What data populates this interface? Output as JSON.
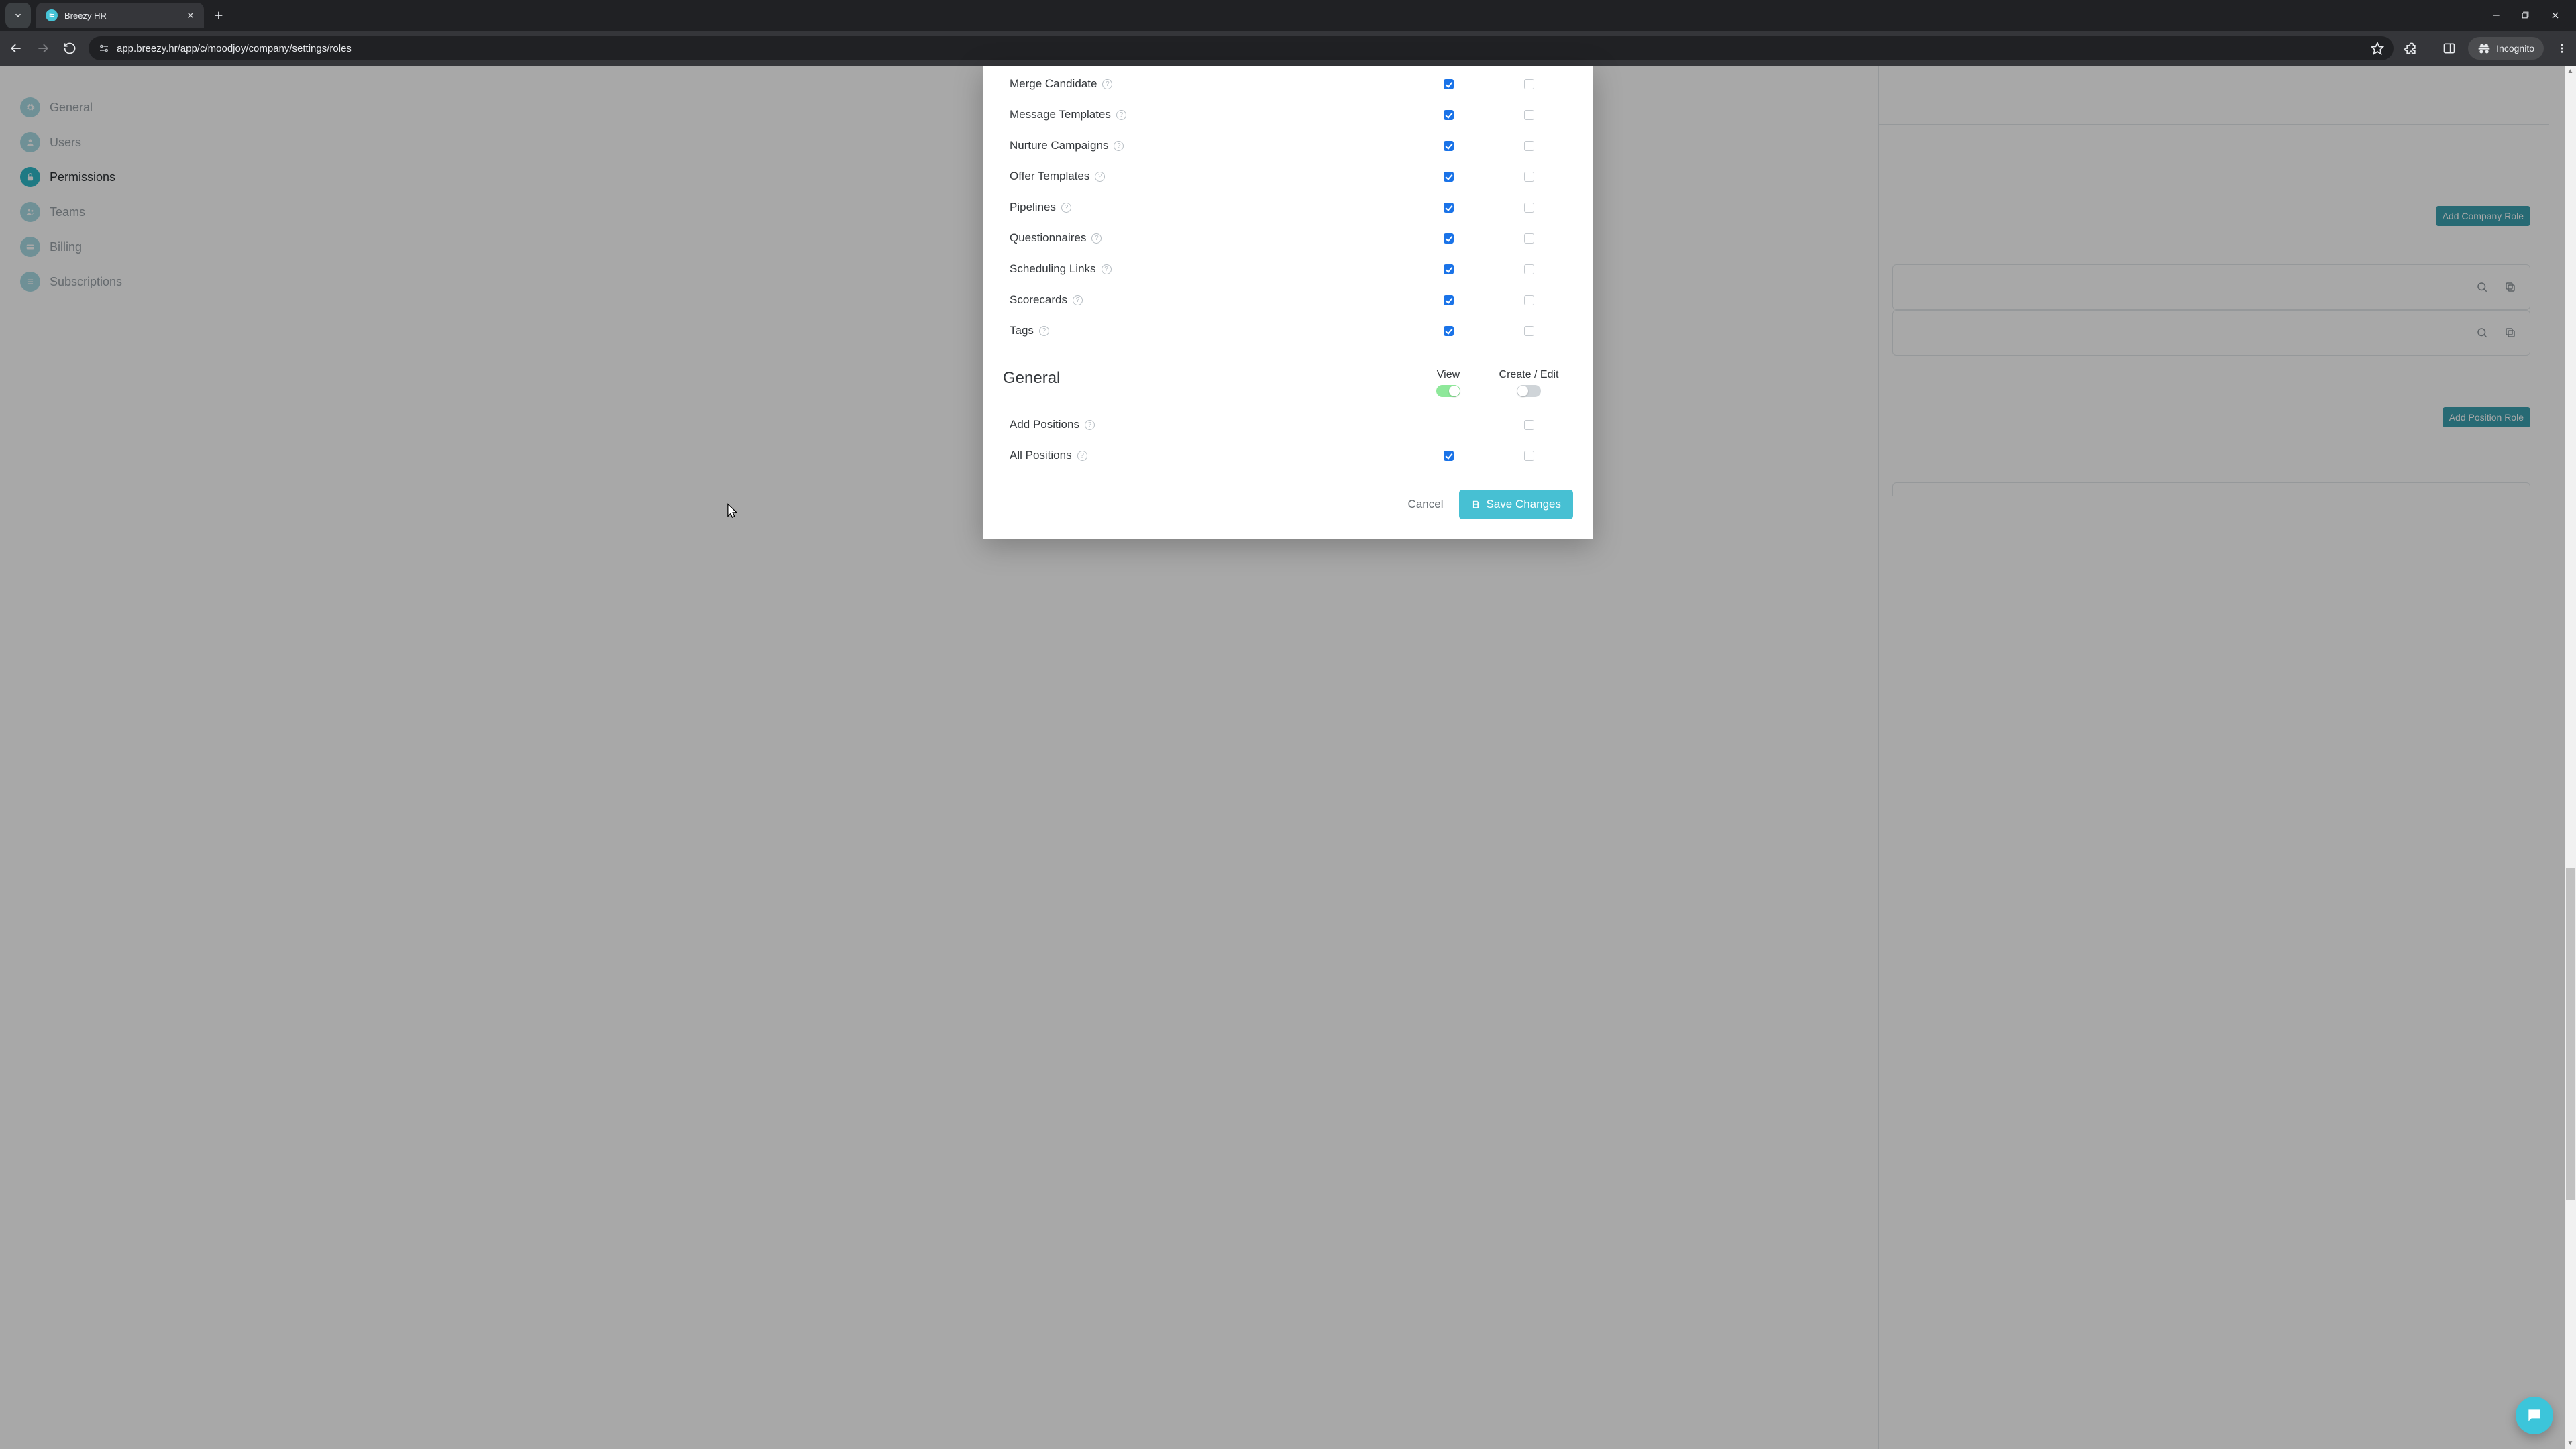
{
  "browser": {
    "tab_title": "Breezy HR",
    "url": "app.breezy.hr/app/c/moodjoy/company/settings/roles",
    "incognito_label": "Incognito"
  },
  "sidebar": {
    "items": [
      {
        "label": "General"
      },
      {
        "label": "Users"
      },
      {
        "label": "Permissions"
      },
      {
        "label": "Teams"
      },
      {
        "label": "Billing"
      },
      {
        "label": "Subscriptions"
      }
    ]
  },
  "background": {
    "add_company_role": "Add Company Role",
    "add_position_role": "Add Position Role"
  },
  "permissions": {
    "rows": [
      {
        "label": "Merge Candidate",
        "view": true,
        "edit": false
      },
      {
        "label": "Message Templates",
        "view": true,
        "edit": false
      },
      {
        "label": "Nurture Campaigns",
        "view": true,
        "edit": false
      },
      {
        "label": "Offer Templates",
        "view": true,
        "edit": false
      },
      {
        "label": "Pipelines",
        "view": true,
        "edit": false
      },
      {
        "label": "Questionnaires",
        "view": true,
        "edit": false
      },
      {
        "label": "Scheduling Links",
        "view": true,
        "edit": false
      },
      {
        "label": "Scorecards",
        "view": true,
        "edit": false
      },
      {
        "label": "Tags",
        "view": true,
        "edit": false
      }
    ]
  },
  "general_section": {
    "title": "General",
    "col_view": "View",
    "col_edit": "Create / Edit",
    "view_toggle_on": true,
    "edit_toggle_on": false,
    "rows": {
      "add_positions": {
        "label": "Add Positions",
        "edit": false
      },
      "all_positions": {
        "label": "All Positions",
        "view": true,
        "edit": false
      }
    }
  },
  "footer": {
    "cancel": "Cancel",
    "save": "Save Changes"
  }
}
